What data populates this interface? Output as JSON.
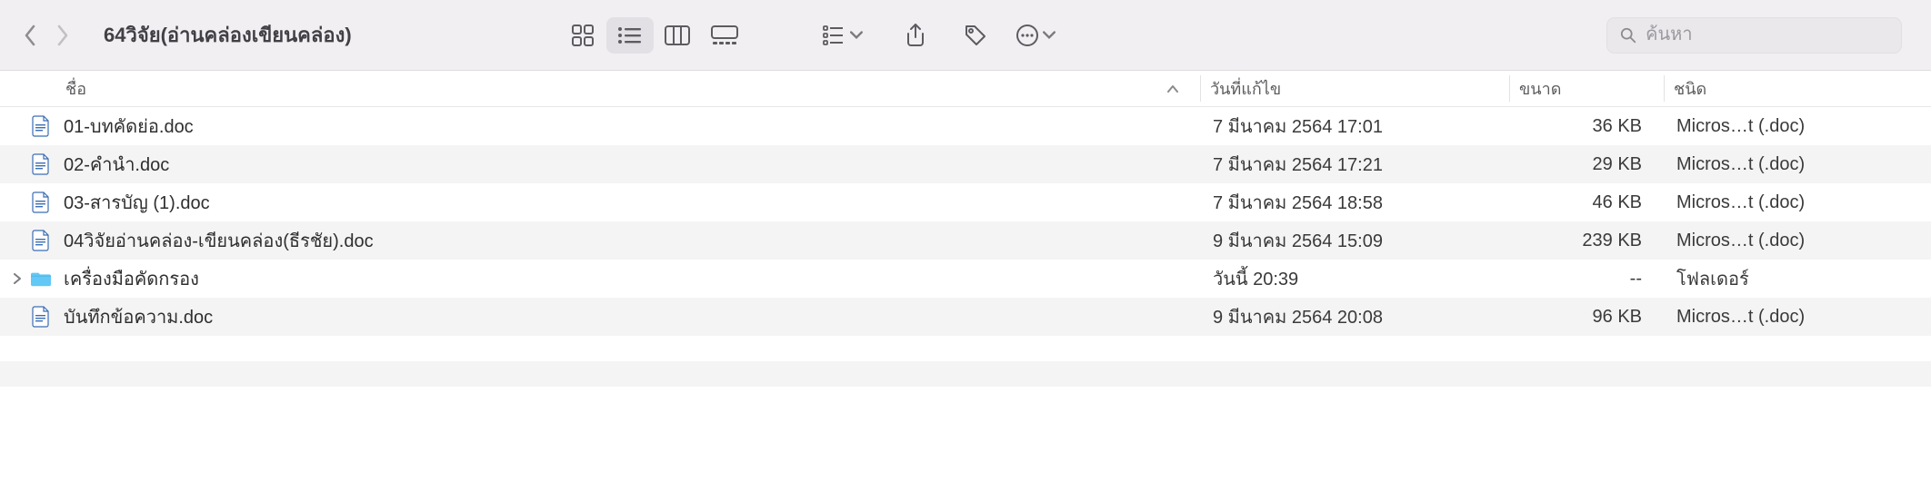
{
  "window": {
    "title": "64วิจัย(อ่านคล่องเขียนคล่อง)"
  },
  "search": {
    "placeholder": "ค้นหา"
  },
  "columns": {
    "name": "ชื่อ",
    "date": "วันที่แก้ไข",
    "size": "ขนาด",
    "kind": "ชนิด"
  },
  "rows": [
    {
      "icon": "doc",
      "name": "01-บทคัดย่อ.doc",
      "date": "7 มีนาคม 2564 17:01",
      "size": "36 KB",
      "kind": "Micros…t (.doc)",
      "expandable": false
    },
    {
      "icon": "doc",
      "name": "02-คำนำ.doc",
      "date": "7 มีนาคม 2564 17:21",
      "size": "29 KB",
      "kind": "Micros…t (.doc)",
      "expandable": false
    },
    {
      "icon": "doc",
      "name": "03-สารบัญ (1).doc",
      "date": "7 มีนาคม 2564 18:58",
      "size": "46 KB",
      "kind": "Micros…t (.doc)",
      "expandable": false
    },
    {
      "icon": "doc",
      "name": "04วิจัยอ่านคล่อง-เขียนคล่อง(ธีรชัย).doc",
      "date": "9 มีนาคม 2564 15:09",
      "size": "239 KB",
      "kind": "Micros…t (.doc)",
      "expandable": false
    },
    {
      "icon": "folder",
      "name": "เครื่องมือคัดกรอง",
      "date": "วันนี้ 20:39",
      "size": "--",
      "kind": "โฟลเดอร์",
      "expandable": true
    },
    {
      "icon": "doc",
      "name": "บันทึกข้อความ.doc",
      "date": "9 มีนาคม 2564 20:08",
      "size": "96 KB",
      "kind": "Micros…t (.doc)",
      "expandable": false
    }
  ]
}
